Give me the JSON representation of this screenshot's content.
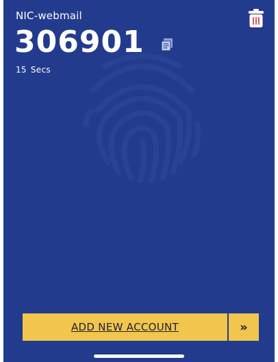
{
  "account": {
    "name": "NIC-webmail",
    "otp_code": "306901",
    "timer_value": "15",
    "timer_unit": "Secs"
  },
  "actions": {
    "add_account_label": "ADD NEW ACCOUNT",
    "next_glyph": "»"
  },
  "icons": {
    "copy": "copy-icon",
    "delete": "trash-icon",
    "fingerprint": "fingerprint-icon"
  },
  "colors": {
    "background": "#233b8d",
    "accent": "#f2c64d",
    "text": "#ffffff",
    "trash_accent": "#e0566b"
  }
}
